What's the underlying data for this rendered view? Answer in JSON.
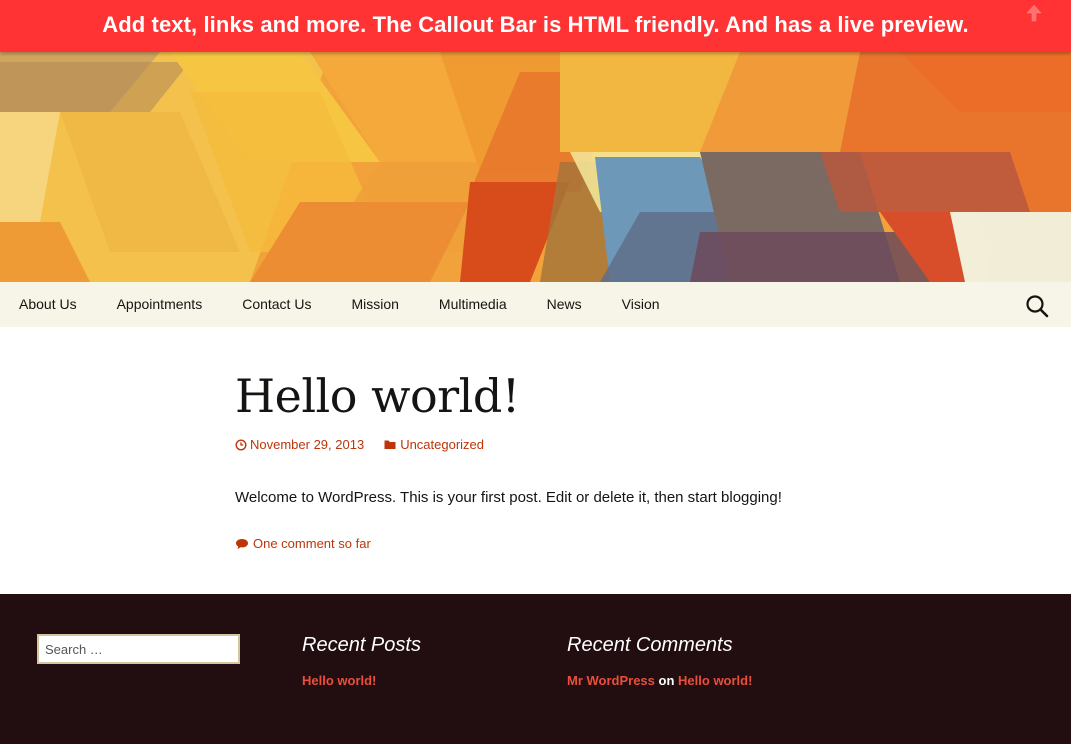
{
  "callout": {
    "text": "Add text, links and more. The Callout Bar is HTML friendly. And has a live preview.",
    "toggle_icon": "arrow-up-icon",
    "background": "#ff3333"
  },
  "nav": {
    "items": [
      "About Us",
      "Appointments",
      "Contact Us",
      "Mission",
      "Multimedia",
      "News",
      "Vision"
    ],
    "search_icon": "search-icon"
  },
  "post": {
    "title": "Hello world!",
    "date": "November 29, 2013",
    "category": "Uncategorized",
    "content": "Welcome to WordPress. This is your first post. Edit or delete it, then start blogging!",
    "comments": "One comment so far"
  },
  "footer": {
    "search_placeholder": "Search …",
    "recent_posts": {
      "title": "Recent Posts",
      "items": [
        "Hello world!"
      ]
    },
    "recent_comments": {
      "title": "Recent Comments",
      "author": "Mr WordPress",
      "connector": "on",
      "post": "Hello world!"
    }
  },
  "colors": {
    "accent": "#bc360a",
    "footer_bg": "#220e10",
    "footer_link": "#ea4e3c",
    "nav_bg": "#f7f5e7"
  }
}
